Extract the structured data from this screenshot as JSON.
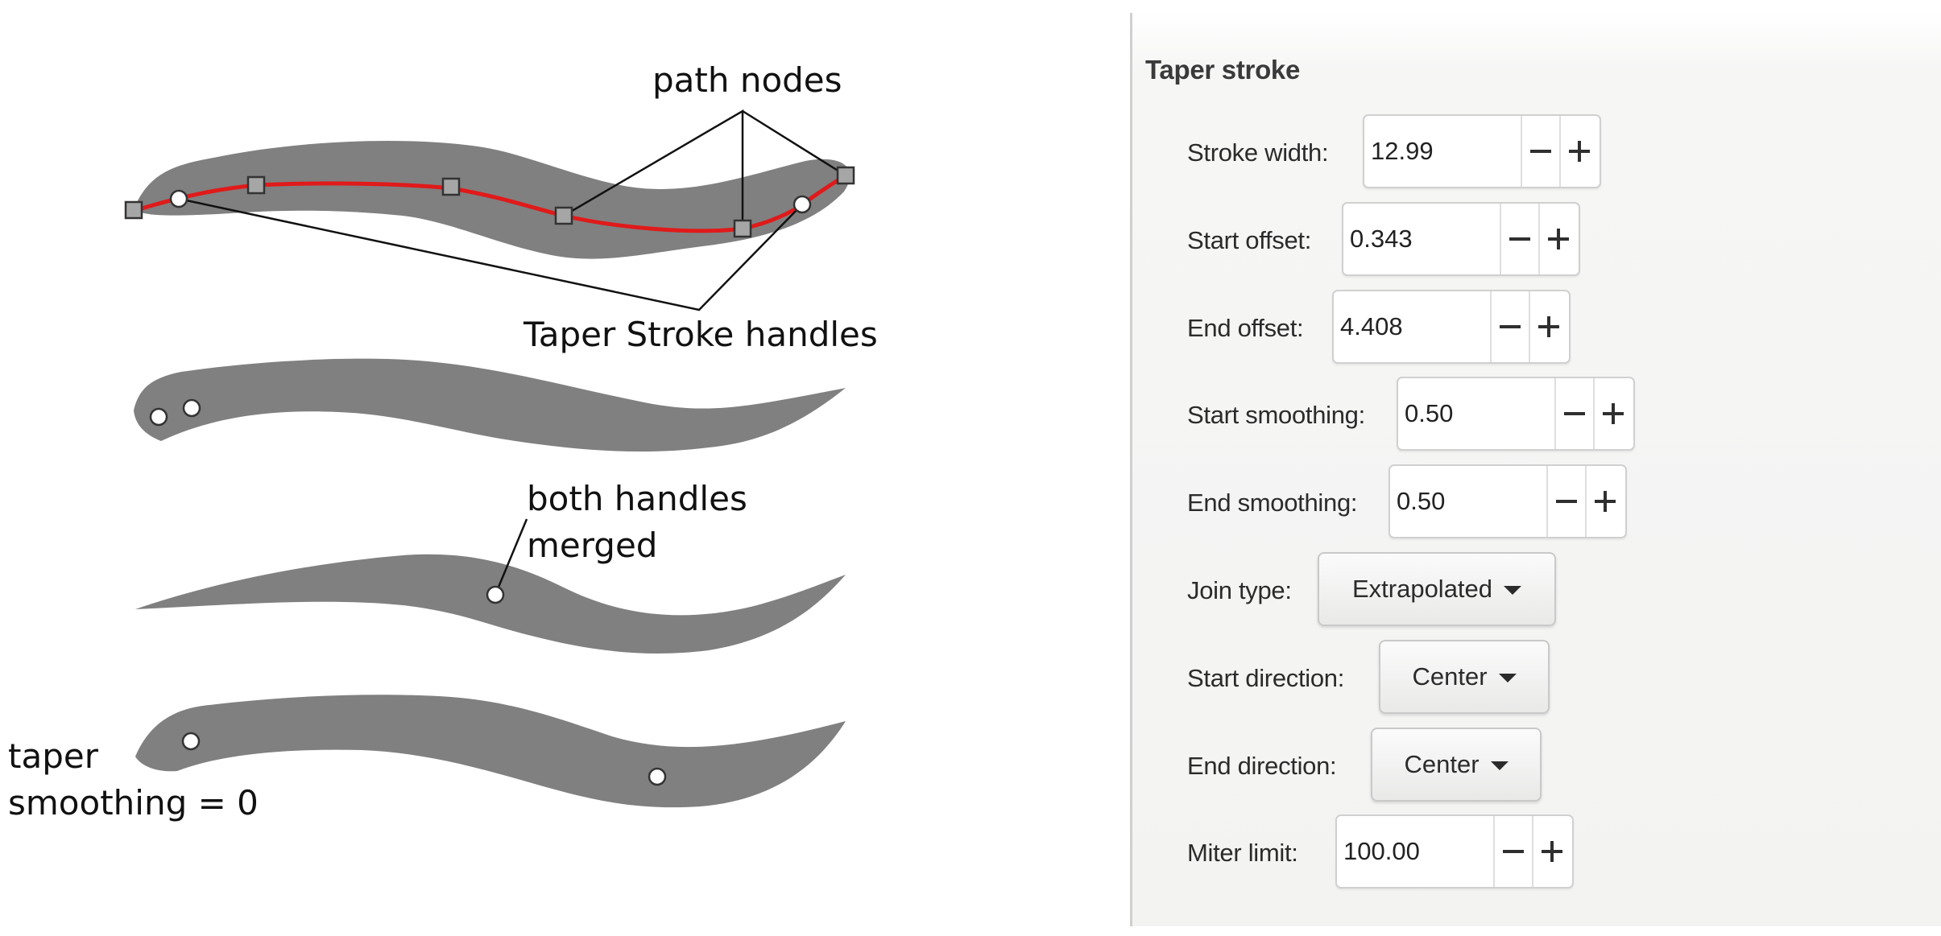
{
  "annotations": {
    "path_nodes": "path nodes",
    "taper_handles": "Taper Stroke handles",
    "both_handles_line1": "both handles",
    "both_handles_line2": "merged",
    "taper_smoothing_line1": "taper",
    "taper_smoothing_line2": "smoothing = 0"
  },
  "colors": {
    "shape_fill": "#808080",
    "path_stroke": "#e01a1a",
    "node_fill": "#a6a6a6",
    "handle_fill": "#ffffff"
  },
  "panel": {
    "title": "Taper stroke",
    "stroke_width": {
      "label": "Stroke width:",
      "value": "12.99"
    },
    "start_offset": {
      "label": "Start offset:",
      "value": "0.343"
    },
    "end_offset": {
      "label": "End offset:",
      "value": "4.408"
    },
    "start_smoothing": {
      "label": "Start smoothing:",
      "value": "0.50"
    },
    "end_smoothing": {
      "label": "End smoothing:",
      "value": "0.50"
    },
    "join_type": {
      "label": "Join type:",
      "value": "Extrapolated"
    },
    "start_direction": {
      "label": "Start direction:",
      "value": "Center"
    },
    "end_direction": {
      "label": "End direction:",
      "value": "Center"
    },
    "miter_limit": {
      "label": "Miter limit:",
      "value": "100.00"
    }
  }
}
